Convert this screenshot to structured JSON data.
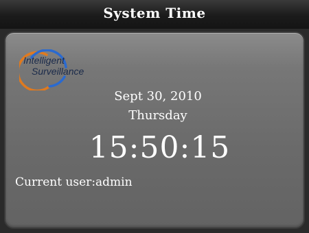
{
  "window": {
    "title": "System Time"
  },
  "logo": {
    "line1": "Intelligent",
    "line2": "Surveillance",
    "ring_colors": [
      "#e07a1f",
      "#2a6ad0"
    ]
  },
  "clock": {
    "date": "Sept 30, 2010",
    "weekday": "Thursday",
    "time": "15:50:15"
  },
  "session": {
    "current_user_text": "Current user:admin"
  },
  "colors": {
    "titlebar_bg": "#1b1b1b",
    "panel_bg": "#6f6f6f",
    "text": "#ffffff"
  }
}
